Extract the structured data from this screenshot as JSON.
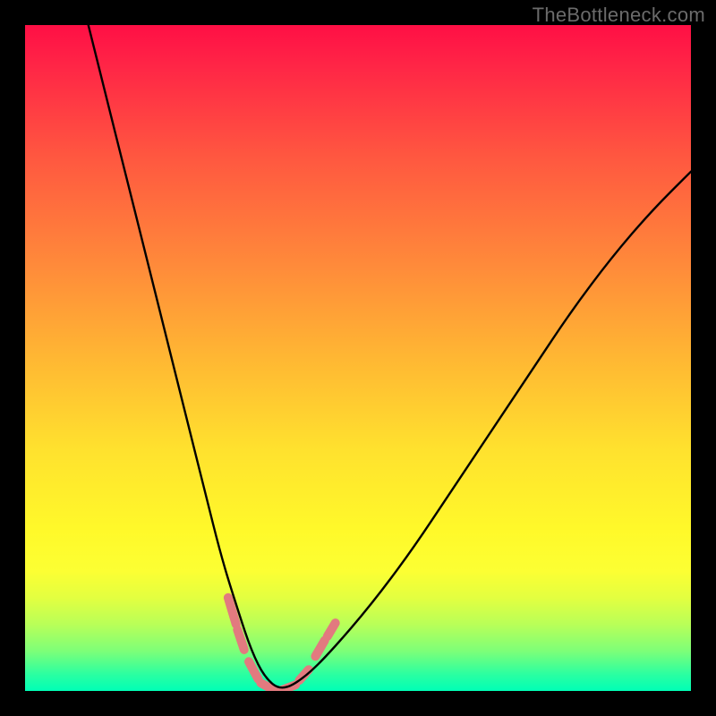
{
  "watermark": "TheBottleneck.com",
  "chart_data": {
    "type": "line",
    "title": "",
    "xlabel": "",
    "ylabel": "",
    "xlim": [
      0,
      100
    ],
    "ylim": [
      0,
      100
    ],
    "grid": false,
    "legend": false,
    "description": "Bottleneck curve: steep V-shaped black line dipping to a flat minimum near the bottom-left third over a vertical red→yellow→green gradient background. Pink dashed segments cluster around the minimum.",
    "series": [
      {
        "name": "bottleneck-curve",
        "color": "#000000",
        "x": [
          9.5,
          12,
          15,
          18,
          21,
          24,
          27,
          29.5,
          32,
          34,
          36,
          38.5,
          42,
          46,
          52,
          58,
          64,
          70,
          76,
          82,
          88,
          94,
          100
        ],
        "values": [
          100,
          90,
          78,
          66,
          54,
          42,
          30,
          20,
          12,
          6,
          2,
          0,
          2,
          6,
          13,
          21,
          30,
          39,
          48,
          57,
          65,
          72,
          78
        ]
      },
      {
        "name": "min-markers",
        "render": "dashes",
        "color": "#e27a7f",
        "stroke_width": 10,
        "segments": [
          {
            "x1": 30.5,
            "y1": 14.0,
            "x2": 31.7,
            "y2": 10.0
          },
          {
            "x1": 31.9,
            "y1": 9.2,
            "x2": 32.9,
            "y2": 6.2
          },
          {
            "x1": 33.6,
            "y1": 4.4,
            "x2": 35.0,
            "y2": 1.8
          },
          {
            "x1": 35.4,
            "y1": 1.2,
            "x2": 37.6,
            "y2": 0.0
          },
          {
            "x1": 38.2,
            "y1": 0.0,
            "x2": 40.6,
            "y2": 0.9
          },
          {
            "x1": 41.2,
            "y1": 1.6,
            "x2": 42.6,
            "y2": 3.2
          },
          {
            "x1": 43.6,
            "y1": 5.2,
            "x2": 45.0,
            "y2": 7.6
          },
          {
            "x1": 45.4,
            "y1": 8.2,
            "x2": 46.6,
            "y2": 10.2
          }
        ]
      }
    ],
    "gradient_stops": [
      {
        "pos": 0.0,
        "color": "#ff0f45"
      },
      {
        "pos": 0.06,
        "color": "#ff2546"
      },
      {
        "pos": 0.2,
        "color": "#ff5840"
      },
      {
        "pos": 0.36,
        "color": "#ff8a3a"
      },
      {
        "pos": 0.5,
        "color": "#ffb733"
      },
      {
        "pos": 0.64,
        "color": "#ffe22e"
      },
      {
        "pos": 0.76,
        "color": "#fff92a"
      },
      {
        "pos": 0.82,
        "color": "#fcff33"
      },
      {
        "pos": 0.86,
        "color": "#e3ff40"
      },
      {
        "pos": 0.9,
        "color": "#b9ff58"
      },
      {
        "pos": 0.94,
        "color": "#7dff78"
      },
      {
        "pos": 0.975,
        "color": "#2bffa1"
      },
      {
        "pos": 1.0,
        "color": "#00ffb6"
      }
    ]
  }
}
